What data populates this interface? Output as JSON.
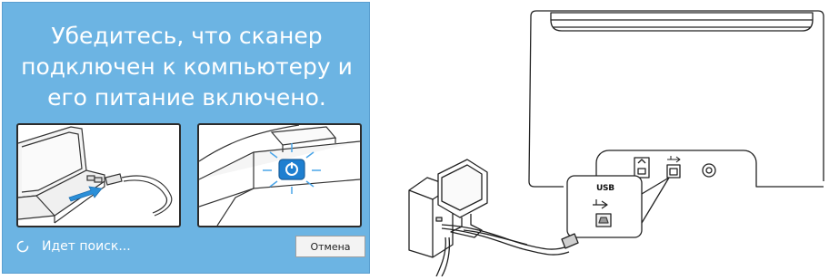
{
  "dialog": {
    "headline_lines": [
      "Убедитесь, что сканер",
      "подключен к компьютеру и",
      "его питание включено."
    ],
    "status_text": "Идет поиск...",
    "cancel_label": "Отмена",
    "background_color": "#6cb4e3"
  },
  "illustration": {
    "port_label": "USB"
  }
}
